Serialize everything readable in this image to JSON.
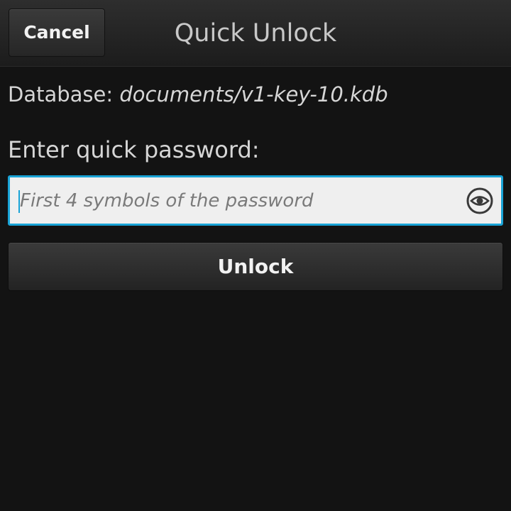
{
  "header": {
    "cancel_label": "Cancel",
    "title": "Quick Unlock"
  },
  "database": {
    "label": "Database:",
    "path": "documents/v1-key-10.kdb"
  },
  "password": {
    "label": "Enter quick password:",
    "value": "",
    "placeholder": "First 4 symbols of the password",
    "reveal_icon": "eye-icon"
  },
  "actions": {
    "unlock_label": "Unlock"
  },
  "colors": {
    "background": "#131313",
    "accent": "#19a3d6",
    "field_background": "#efefef"
  }
}
